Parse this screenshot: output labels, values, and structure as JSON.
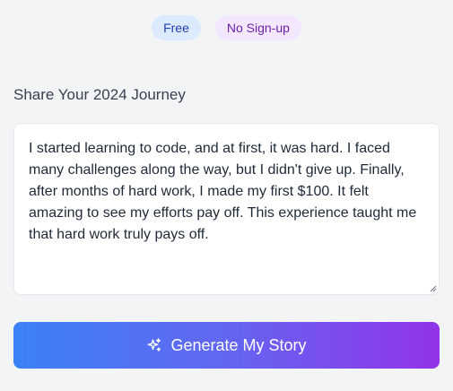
{
  "badges": {
    "free": "Free",
    "no_signup": "No Sign-up"
  },
  "journey": {
    "label": "Share Your 2024 Journey",
    "story": "I started learning to code, and at first, it was hard. I faced many challenges along the way, but I didn't give up. Finally, after months of hard work, I made my first $100. It felt amazing to see my efforts pay off. This experience taught me that hard work truly pays off."
  },
  "generate_button": {
    "label": "Generate My Story",
    "icon": "sparkles-icon"
  },
  "colors": {
    "gradient_start": "#3b82f6",
    "gradient_end": "#9333ea",
    "free_badge_bg": "#dbeafe",
    "no_signup_badge_bg": "#f3e8ff"
  }
}
